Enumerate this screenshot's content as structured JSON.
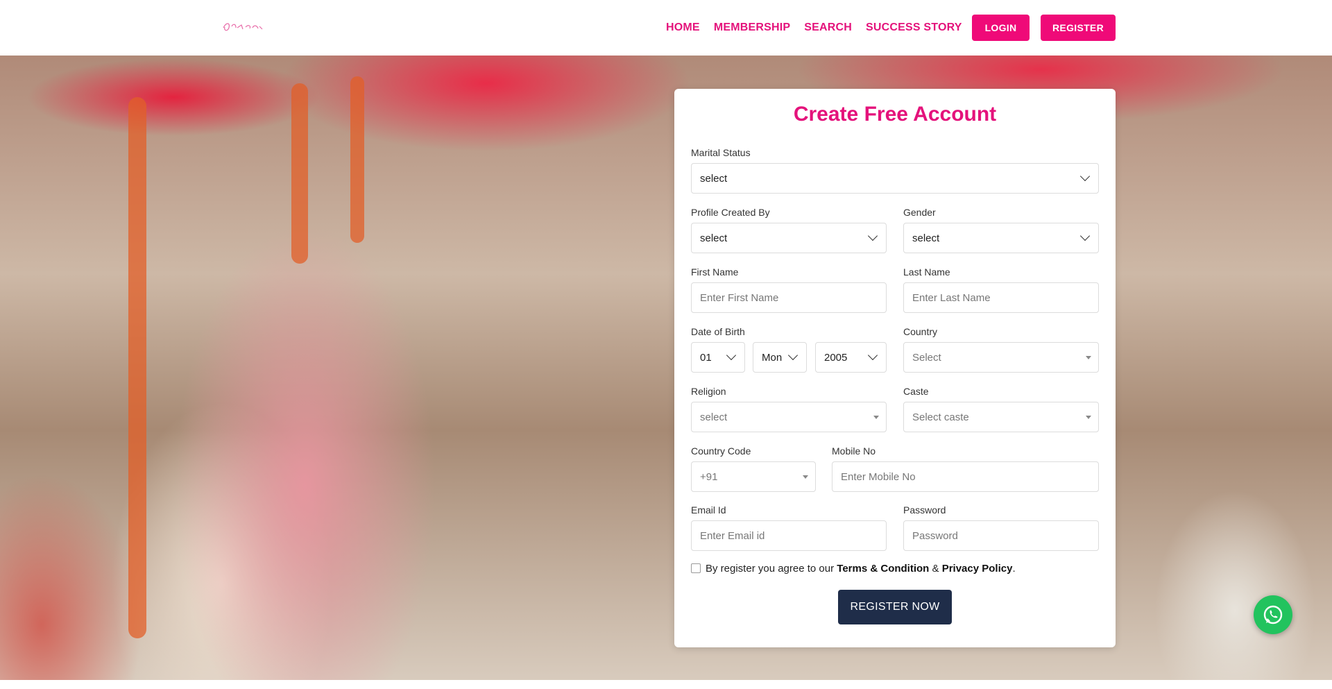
{
  "nav": {
    "links": [
      "HOME",
      "MEMBERSHIP",
      "SEARCH",
      "SUCCESS STORY"
    ],
    "login_label": "LOGIN",
    "register_label": "REGISTER"
  },
  "form": {
    "title": "Create Free Account",
    "marital_status": {
      "label": "Marital Status",
      "value": "select"
    },
    "profile_created_by": {
      "label": "Profile Created By",
      "value": "select"
    },
    "gender": {
      "label": "Gender",
      "value": "select"
    },
    "first_name": {
      "label": "First Name",
      "placeholder": "Enter First Name"
    },
    "last_name": {
      "label": "Last Name",
      "placeholder": "Enter Last Name"
    },
    "dob": {
      "label": "Date of Birth",
      "day": "01",
      "month": "Mon",
      "year": "2005"
    },
    "country": {
      "label": "Country",
      "value": "Select"
    },
    "religion": {
      "label": "Religion",
      "value": "select"
    },
    "caste": {
      "label": "Caste",
      "value": "Select caste"
    },
    "country_code": {
      "label": "Country Code",
      "value": "+91"
    },
    "mobile": {
      "label": "Mobile No",
      "placeholder": "Enter Mobile No"
    },
    "email": {
      "label": "Email Id",
      "placeholder": "Enter Email id"
    },
    "password": {
      "label": "Password",
      "placeholder": "Password"
    },
    "terms": {
      "prefix": "By register you agree to our",
      "terms_link": "Terms & Condition",
      "amp": "&",
      "privacy_link": "Privacy Policy",
      "suffix": "."
    },
    "submit_label": "REGISTER NOW"
  },
  "colors": {
    "brand_pink": "#e4127b",
    "button_pink": "#ef0a78",
    "submit_navy": "#1f2d49",
    "whatsapp_green": "#22c35e"
  },
  "icons": {
    "whatsapp": "whatsapp-icon",
    "dropdown": "chevron-down-icon"
  }
}
